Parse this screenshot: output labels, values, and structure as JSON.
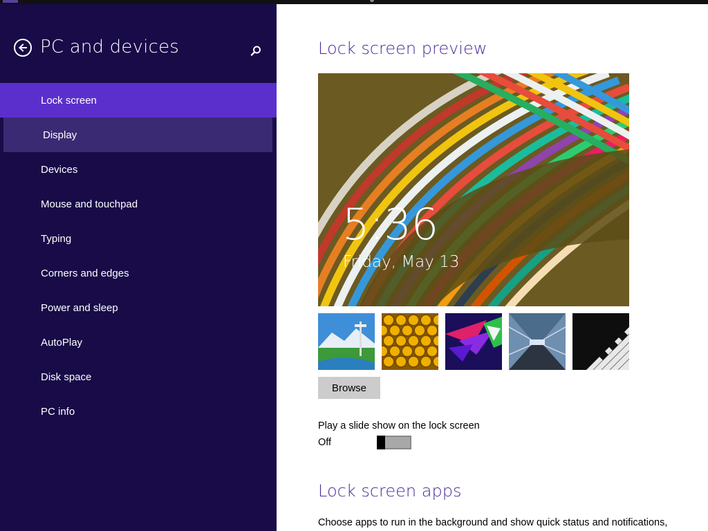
{
  "sidebar": {
    "title": "PC and devices",
    "back_icon": "back-arrow-icon",
    "search_icon": "search-icon",
    "items": [
      {
        "label": "Lock screen",
        "state": "selected"
      },
      {
        "label": "Display",
        "state": "hover"
      },
      {
        "label": "Devices"
      },
      {
        "label": "Mouse and touchpad"
      },
      {
        "label": "Typing"
      },
      {
        "label": "Corners and edges"
      },
      {
        "label": "Power and sleep"
      },
      {
        "label": "AutoPlay"
      },
      {
        "label": "Disk space"
      },
      {
        "label": "PC info"
      }
    ]
  },
  "main": {
    "preview_heading": "Lock screen preview",
    "preview": {
      "time": "5:36",
      "date": "Friday, May 13"
    },
    "thumbnails": [
      "space-needle-mountain",
      "honeycomb",
      "purple-prism",
      "train-tunnel",
      "piano-keys"
    ],
    "browse_label": "Browse",
    "slideshow": {
      "label": "Play a slide show on the lock screen",
      "state": "Off"
    },
    "apps_heading": "Lock screen apps",
    "apps_description": "Choose apps to run in the background and show quick status and notifications,"
  },
  "colors": {
    "sidebar_bg": "#180b48",
    "selected_bg": "#5b2fcc",
    "hover_bg": "#3a2a73",
    "heading": "#4a2a9a"
  }
}
